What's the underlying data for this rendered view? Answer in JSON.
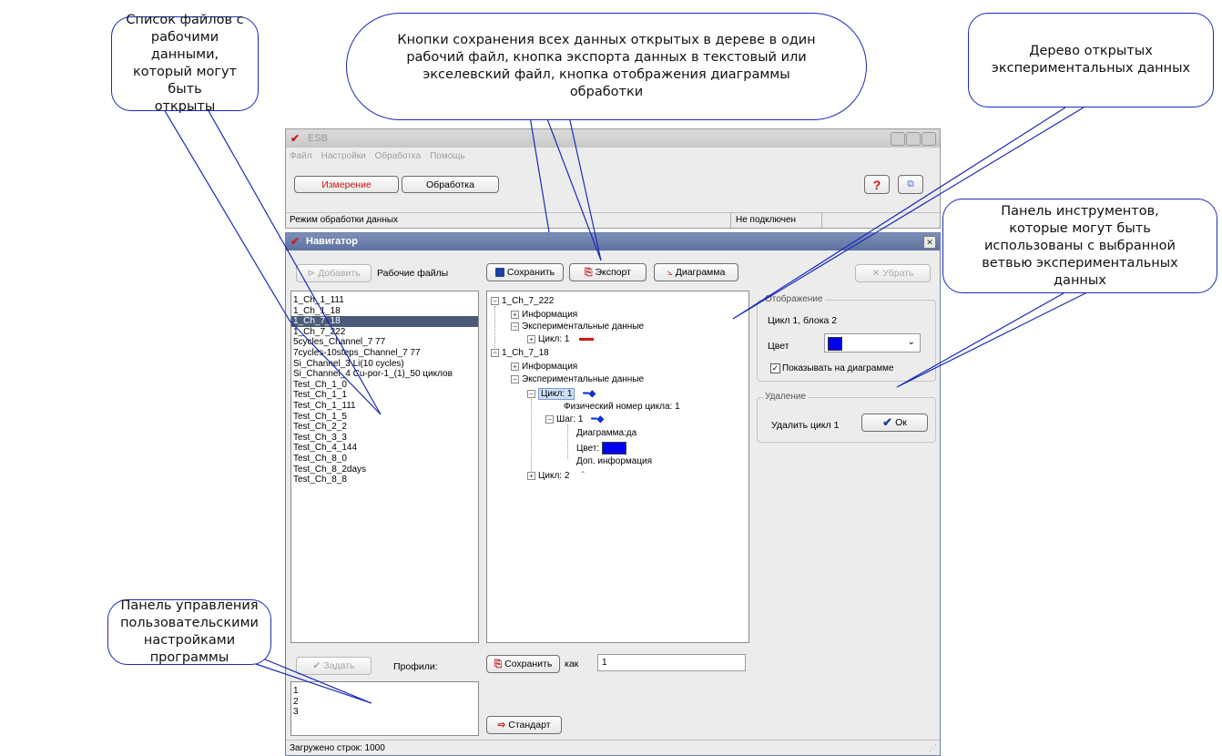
{
  "callouts": {
    "files": "Список файлов с\nрабочими данными,\nкоторый могут быть\nоткрыты",
    "buttons": "Кнопки сохранения всех данных открытых в дереве в один\nрабочий файл, кнопка экспорта данных в текстовый или\nэкселевский файл, кнопка отображения диаграммы\nобработки",
    "tree": "Дерево открытых\nэкспериментальных данных",
    "tools": "Панель инструментов,\nкоторые могут быть\nиспользованы с выбранной\nветвью экспериментальных\nданных",
    "profiles": "Панель управления\nпользовательскими\nнастройками программы"
  },
  "main_window": {
    "title": "ESB",
    "menu": [
      "Файл",
      "Настройки",
      "Обработка",
      "Помощь"
    ],
    "tab_measure": "Измерение",
    "tab_process": "Обработка",
    "status_mode": "Режим обработки данных",
    "status_conn": "Не подключен"
  },
  "navigator": {
    "title": "Навигатор",
    "add_button": "Добавить",
    "files_label": "Рабочие файлы",
    "save_button": "Сохранить",
    "export_button": "Экспорт",
    "diagram_button": "Диаграмма",
    "remove_button": "Убрать",
    "files": [
      "1_Ch_1_111",
      "1_Ch_1_18",
      "1_Ch_7_18",
      "1_Ch_7_222",
      "5cycles_Channel_7 77",
      "7cycles-10steps_Channel_7 77",
      "Si_Channel_3 Li(10 cycles)",
      "Si_Channel_4 Cu-por-1_(1)_50 циклов",
      "Test_Ch_1_0",
      "Test_Ch_1_1",
      "Test_Ch_1_111",
      "Test_Ch_1_5",
      "Test_Ch_2_2",
      "Test_Ch_3_3",
      "Test_Ch_4_144",
      "Test_Ch_8_0",
      "Test_Ch_8_2days",
      "Test_Ch_8_8"
    ],
    "selected_file_index": 2,
    "tree": {
      "file1": "1_Ch_7_222",
      "info": "Информация",
      "exp_data": "Экспериментальные данные",
      "cycle1_a": "Цикл: 1",
      "file2": "1_Ch_7_18",
      "cycle1_b": "Цикл: 1",
      "phys_num": "Физический номер цикла: 1",
      "step": "Шаг: 1",
      "diagram": "Диаграмма:да",
      "color": "Цвет:",
      "extra": "Доп. информация",
      "cycle2": "Цикл: 2"
    },
    "display_group": "Отображение",
    "cycle_block": "Цикл 1, блока 2",
    "color_label": "Цвет",
    "show_on_diagram": "Показывать на диаграмме",
    "delete_group": "Удаление",
    "delete_label": "Удалить цикл 1",
    "ok_button": "Ок",
    "set_button": "Задать",
    "profiles_label": "Профили:",
    "profiles": [
      "1",
      "2",
      "3"
    ],
    "save_as_button": "Сохранить",
    "as_label": "как",
    "profile_name": "1",
    "standard_button": "Стандарт",
    "status_loaded": "Загружено строк: 1000"
  },
  "colors": {
    "callout_border": "#1c2bb8",
    "selection": "#4a5a78",
    "cycle_red": "#d81818",
    "cycle_blue": "#1030d0",
    "swatch_blue": "#0000ee"
  }
}
